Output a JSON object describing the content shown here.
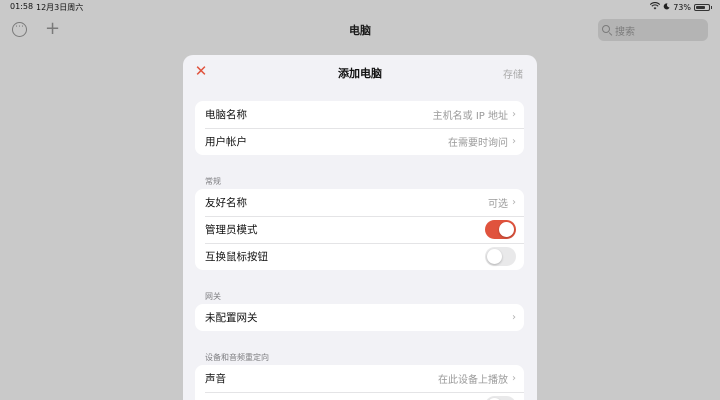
{
  "status_bar": {
    "time": "01:58",
    "date": "12月3日周六",
    "battery": "73%"
  },
  "topbar": {
    "title": "电脑",
    "search_placeholder": "搜索"
  },
  "modal": {
    "title": "添加电脑",
    "save_label": "存储",
    "group1": [
      {
        "label": "电脑名称",
        "value": "主机名或 IP 地址"
      },
      {
        "label": "用户帐户",
        "value": "在需要时询问"
      }
    ],
    "section_general": "常规",
    "group2": [
      {
        "label": "友好名称",
        "value": "可选"
      },
      {
        "label": "管理员模式",
        "toggle": true
      },
      {
        "label": "互换鼠标按钮",
        "toggle": false
      }
    ],
    "section_gateway": "网关",
    "group3": [
      {
        "label": "未配置网关"
      }
    ],
    "section_redirect": "设备和音频重定向",
    "group4": [
      {
        "label": "声音",
        "value": "在此设备上播放"
      },
      {
        "label": "",
        "toggle": false
      }
    ]
  },
  "colors": {
    "accent": "#e0533d",
    "toggle_off": "#e9e9ea",
    "backdrop": "#c9c9c9"
  }
}
